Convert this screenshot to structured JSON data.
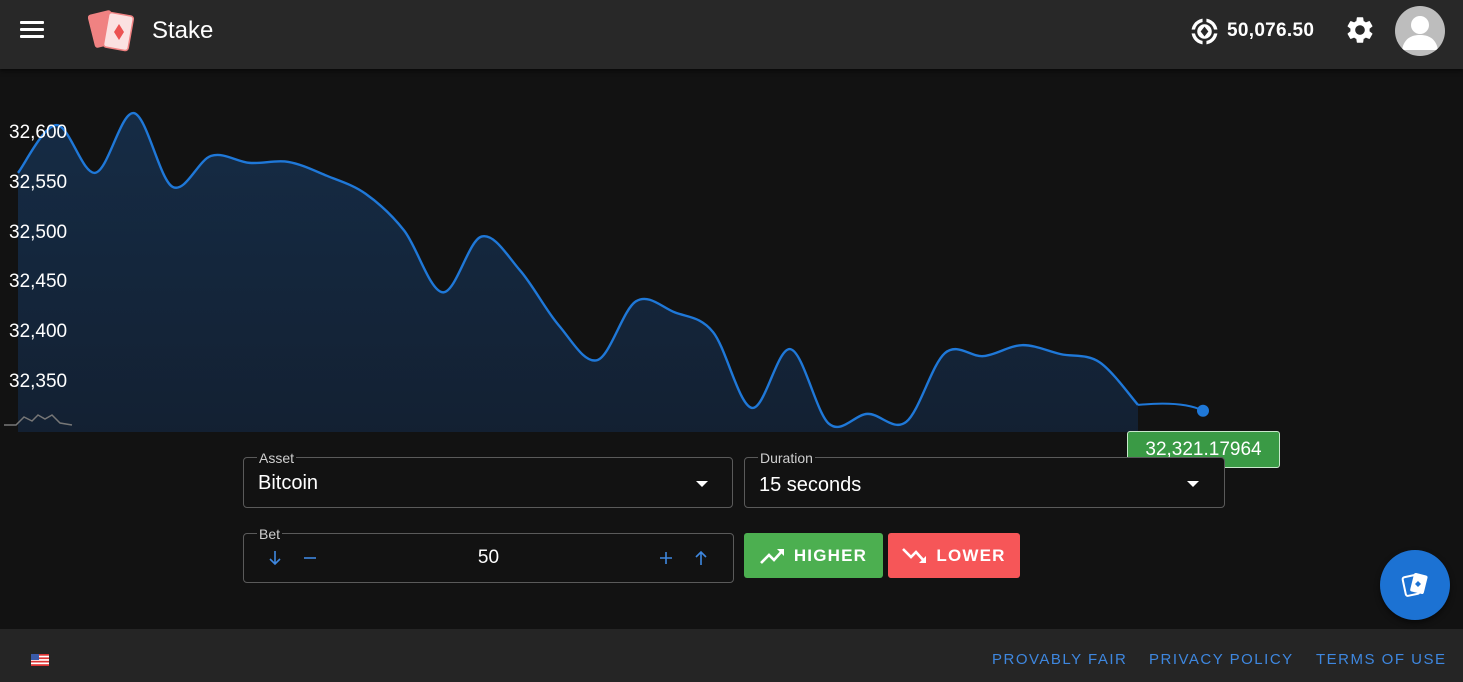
{
  "header": {
    "brand": "Stake",
    "balance": "50,076.50",
    "icons": {
      "menu": "hamburger-menu-icon",
      "logo": "playing-cards-icon",
      "balance": "casino-chip-icon",
      "settings": "gear-icon",
      "avatar": "user-avatar-icon"
    }
  },
  "chart": {
    "y_ticks": [
      "32,600",
      "32,550",
      "32,500",
      "32,450",
      "32,400",
      "32,350"
    ],
    "current_price": "32,321.17964",
    "line_color": "#1f78d8",
    "tag_color": "#3a9a45"
  },
  "chart_data": {
    "type": "area",
    "title": "",
    "xlabel": "",
    "ylabel": "",
    "ylim": [
      32310,
      32660
    ],
    "y_ticks": [
      32600,
      32550,
      32500,
      32450,
      32400,
      32350
    ],
    "series": [
      {
        "values": [
          32560,
          32608,
          32560,
          32620,
          32546,
          32577,
          32570,
          32571,
          32557,
          32539,
          32502,
          32440,
          32496,
          32462,
          32407,
          32372,
          32431,
          32420,
          32400,
          32324,
          32383,
          32308,
          32318,
          32310,
          32379,
          32376,
          32387,
          32378,
          32370,
          32327
        ]
      }
    ],
    "current_value": 32321.17964,
    "grid": false
  },
  "form": {
    "asset": {
      "label": "Asset",
      "value": "Bitcoin"
    },
    "duration": {
      "label": "Duration",
      "value": "15 seconds"
    },
    "bet": {
      "label": "Bet",
      "value": "50"
    },
    "higher_label": "HIGHER",
    "lower_label": "LOWER",
    "colors": {
      "higher": "#4caf50",
      "lower": "#f65658",
      "accent": "#1c72d3"
    }
  },
  "footer": {
    "links": [
      "PROVABLY FAIR",
      "PRIVACY POLICY",
      "TERMS OF USE"
    ]
  }
}
